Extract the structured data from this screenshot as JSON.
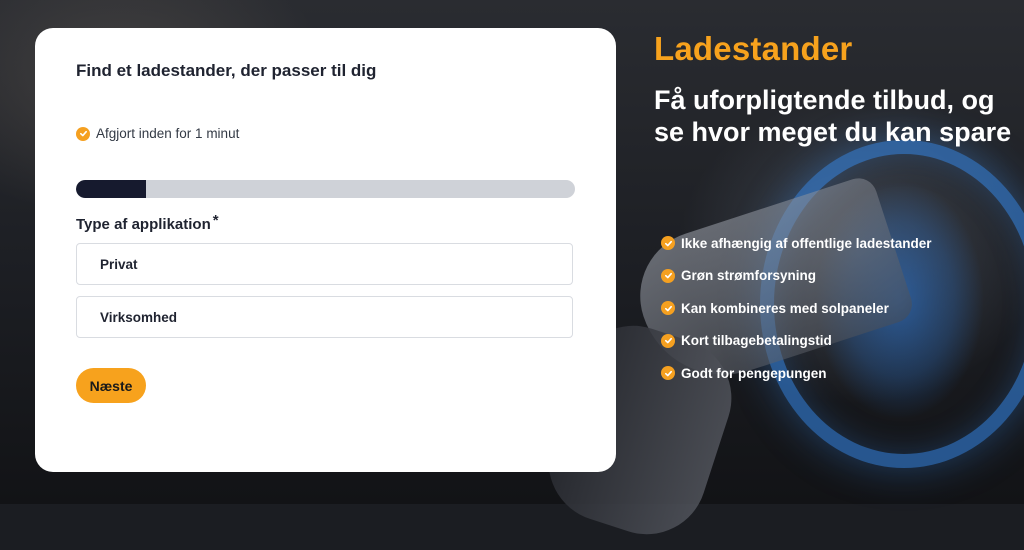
{
  "form": {
    "title": "Find et ladestander, der passer til dig",
    "note": "Afgjort inden for 1 minut",
    "progress_percent": 14,
    "field_label": "Type af applikation",
    "required_marker": "*",
    "options": [
      "Privat",
      "Virksomhed"
    ],
    "next_button": "Næste"
  },
  "hero": {
    "title": "Ladestander",
    "subtitle": "Få uforpligtende tilbud, og se hvor meget du kan spare",
    "benefits": [
      "Ikke afhængig af offentlige ladestander",
      "Grøn strømforsyning",
      "Kan kombineres med solpaneler",
      "Kort tilbagebetalingstid",
      "Godt for pengepungen"
    ]
  },
  "colors": {
    "accent": "#f7a21d",
    "progress_fill": "#161a2e",
    "progress_track": "#cfd2d8"
  }
}
